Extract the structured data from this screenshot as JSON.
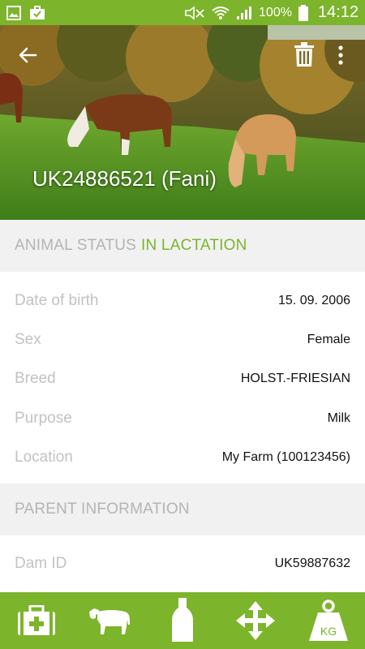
{
  "status_bar": {
    "battery_percent": "100%",
    "time": "14:12",
    "icons": [
      "image-icon",
      "briefcase-check-icon",
      "mute-icon",
      "wifi-icon",
      "signal-icon",
      "battery-icon"
    ]
  },
  "header": {
    "animal_title": "UK24886521 (Fani)",
    "actions": [
      "back-arrow-icon",
      "trash-icon",
      "more-vert-icon"
    ]
  },
  "animal_status": {
    "label": "ANIMAL STATUS",
    "value": "IN LACTATION"
  },
  "details": [
    {
      "label": "Date of birth",
      "value": "15. 09. 2006"
    },
    {
      "label": "Sex",
      "value": "Female"
    },
    {
      "label": "Breed",
      "value": "HOLST.-FRIESIAN"
    },
    {
      "label": "Purpose",
      "value": "Milk"
    },
    {
      "label": "Location",
      "value": "My Farm (100123456)"
    }
  ],
  "parent_section": {
    "title": "PARENT INFORMATION",
    "rows": [
      {
        "label": "Dam ID",
        "value": "UK59887632"
      }
    ]
  },
  "bottom_toolbar": {
    "tools": [
      "medical-kit-icon",
      "cow-icon",
      "milk-bottle-icon",
      "move-arrows-icon",
      "weight-icon"
    ],
    "weight_label": "KG"
  },
  "colors": {
    "accent": "#7cb42b",
    "section_background": "#f1f1f1",
    "label_text": "#c2c2c2",
    "value_text": "#111111"
  }
}
